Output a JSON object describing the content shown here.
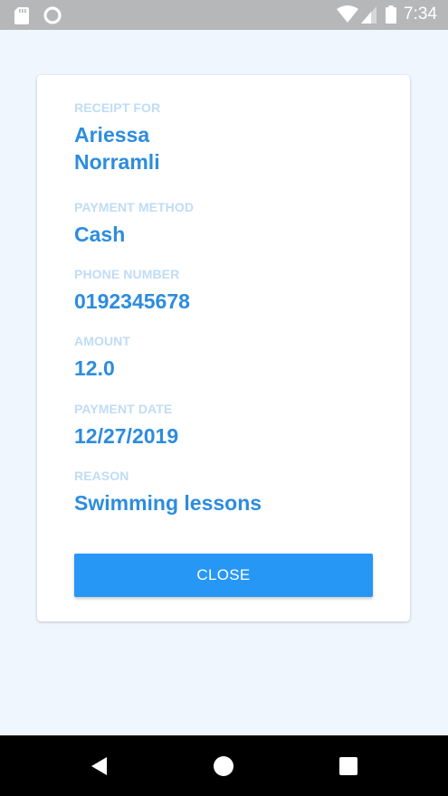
{
  "status_bar": {
    "time": "7:34",
    "icons": [
      "sd-card-icon",
      "circle-icon",
      "wifi-icon",
      "signal-icon",
      "battery-icon"
    ]
  },
  "receipt": {
    "fields": [
      {
        "label": "RECEIPT FOR",
        "value": "Ariessa Norramli"
      },
      {
        "label": "PAYMENT METHOD",
        "value": "Cash"
      },
      {
        "label": "PHONE NUMBER",
        "value": "0192345678"
      },
      {
        "label": "AMOUNT",
        "value": "12.0"
      },
      {
        "label": "PAYMENT DATE",
        "value": "12/27/2019"
      },
      {
        "label": "REASON",
        "value": "Swimming lessons"
      }
    ],
    "close_label": "CLOSE"
  },
  "nav_bar": {
    "icons": [
      "back-icon",
      "home-icon",
      "recents-icon"
    ]
  },
  "colors": {
    "accent": "#2797f5",
    "value_text": "#2d8cde",
    "label_text": "#bfdcf7",
    "background": "#f0f6fd",
    "status_bar": "#b5b7b9",
    "nav_bar": "#000000"
  }
}
